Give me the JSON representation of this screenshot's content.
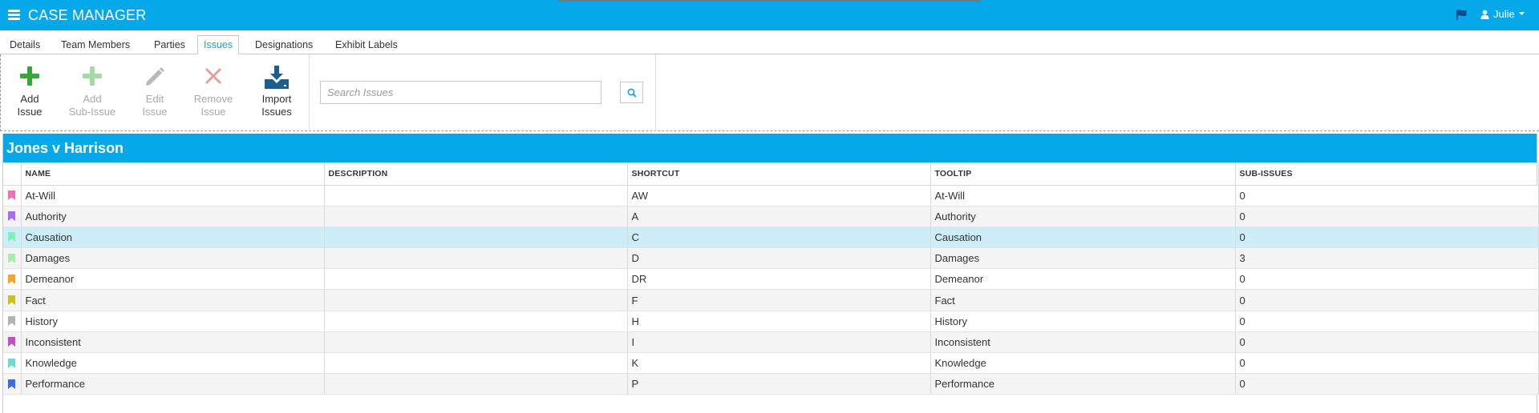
{
  "app": {
    "title": "CASE MANAGER",
    "user_name": "Julie",
    "brand_color": "#05a9e9"
  },
  "tabs": [
    {
      "label": "Details",
      "active": false
    },
    {
      "label": "Team Members",
      "active": false
    },
    {
      "label": "Parties",
      "active": false
    },
    {
      "label": "Issues",
      "active": true
    },
    {
      "label": "Designations",
      "active": false
    },
    {
      "label": "Exhibit Labels",
      "active": false
    }
  ],
  "toolbar": {
    "add_issue": {
      "line1": "Add",
      "line2": "Issue",
      "icon": "plus-icon",
      "enabled": true
    },
    "add_sub_issue": {
      "line1": "Add",
      "line2": "Sub-Issue",
      "icon": "plus-icon",
      "enabled": false
    },
    "edit_issue": {
      "line1": "Edit",
      "line2": "Issue",
      "icon": "pencil-icon",
      "enabled": false
    },
    "remove_issue": {
      "line1": "Remove",
      "line2": "Issue",
      "icon": "x-icon",
      "enabled": false
    },
    "import_issues": {
      "line1": "Import",
      "line2": "Issues",
      "icon": "download-icon",
      "enabled": true
    }
  },
  "search": {
    "placeholder": "Search Issues",
    "value": ""
  },
  "case": {
    "title": "Jones v Harrison"
  },
  "table": {
    "columns": [
      "NAME",
      "DESCRIPTION",
      "SHORTCUT",
      "TOOLTIP",
      "SUB-ISSUES"
    ],
    "rows": [
      {
        "color": "#f06fb5",
        "name": "At-Will",
        "description": "",
        "shortcut": "AW",
        "tooltip": "At-Will",
        "sub_issues": "0"
      },
      {
        "color": "#a86cf0",
        "name": "Authority",
        "description": "",
        "shortcut": "A",
        "tooltip": "Authority",
        "sub_issues": "0"
      },
      {
        "color": "#7ef0c0",
        "name": "Causation",
        "description": "",
        "shortcut": "C",
        "tooltip": "Causation",
        "sub_issues": "0",
        "selected": true
      },
      {
        "color": "#a9eea8",
        "name": "Damages",
        "description": "",
        "shortcut": "D",
        "tooltip": "Damages",
        "sub_issues": "3"
      },
      {
        "color": "#f5a62a",
        "name": "Demeanor",
        "description": "",
        "shortcut": "DR",
        "tooltip": "Demeanor",
        "sub_issues": "0"
      },
      {
        "color": "#c9c21a",
        "name": "Fact",
        "description": "",
        "shortcut": "F",
        "tooltip": "Fact",
        "sub_issues": "0"
      },
      {
        "color": "#b3b3b3",
        "name": "History",
        "description": "",
        "shortcut": "H",
        "tooltip": "History",
        "sub_issues": "0"
      },
      {
        "color": "#c24dc9",
        "name": "Inconsistent",
        "description": "",
        "shortcut": "I",
        "tooltip": "Inconsistent",
        "sub_issues": "0"
      },
      {
        "color": "#6fd9d6",
        "name": "Knowledge",
        "description": "",
        "shortcut": "K",
        "tooltip": "Knowledge",
        "sub_issues": "0"
      },
      {
        "color": "#3b6de0",
        "name": "Performance",
        "description": "",
        "shortcut": "P",
        "tooltip": "Performance",
        "sub_issues": "0"
      }
    ]
  }
}
